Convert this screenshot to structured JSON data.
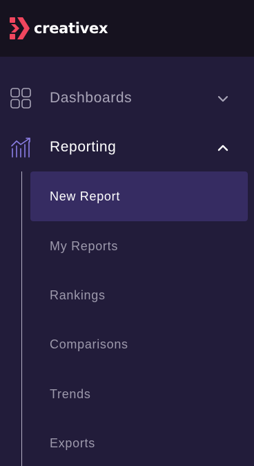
{
  "brand": {
    "name": "creativex",
    "accent": "#f0465e"
  },
  "nav": {
    "groups": [
      {
        "label": "Dashboards",
        "icon": "grid-icon",
        "expanded": false
      },
      {
        "label": "Reporting",
        "icon": "chart-icon",
        "expanded": true,
        "items": [
          {
            "label": "New Report",
            "active": true
          },
          {
            "label": "My Reports",
            "active": false
          },
          {
            "label": "Rankings",
            "active": false
          },
          {
            "label": "Comparisons",
            "active": false
          },
          {
            "label": "Trends",
            "active": false
          },
          {
            "label": "Exports",
            "active": false
          }
        ]
      }
    ]
  },
  "colors": {
    "sidebar_bg": "#221c3a",
    "topbar_bg": "#16121f",
    "active_item_bg": "#362c62",
    "chart_icon": "#8c7fe6"
  }
}
